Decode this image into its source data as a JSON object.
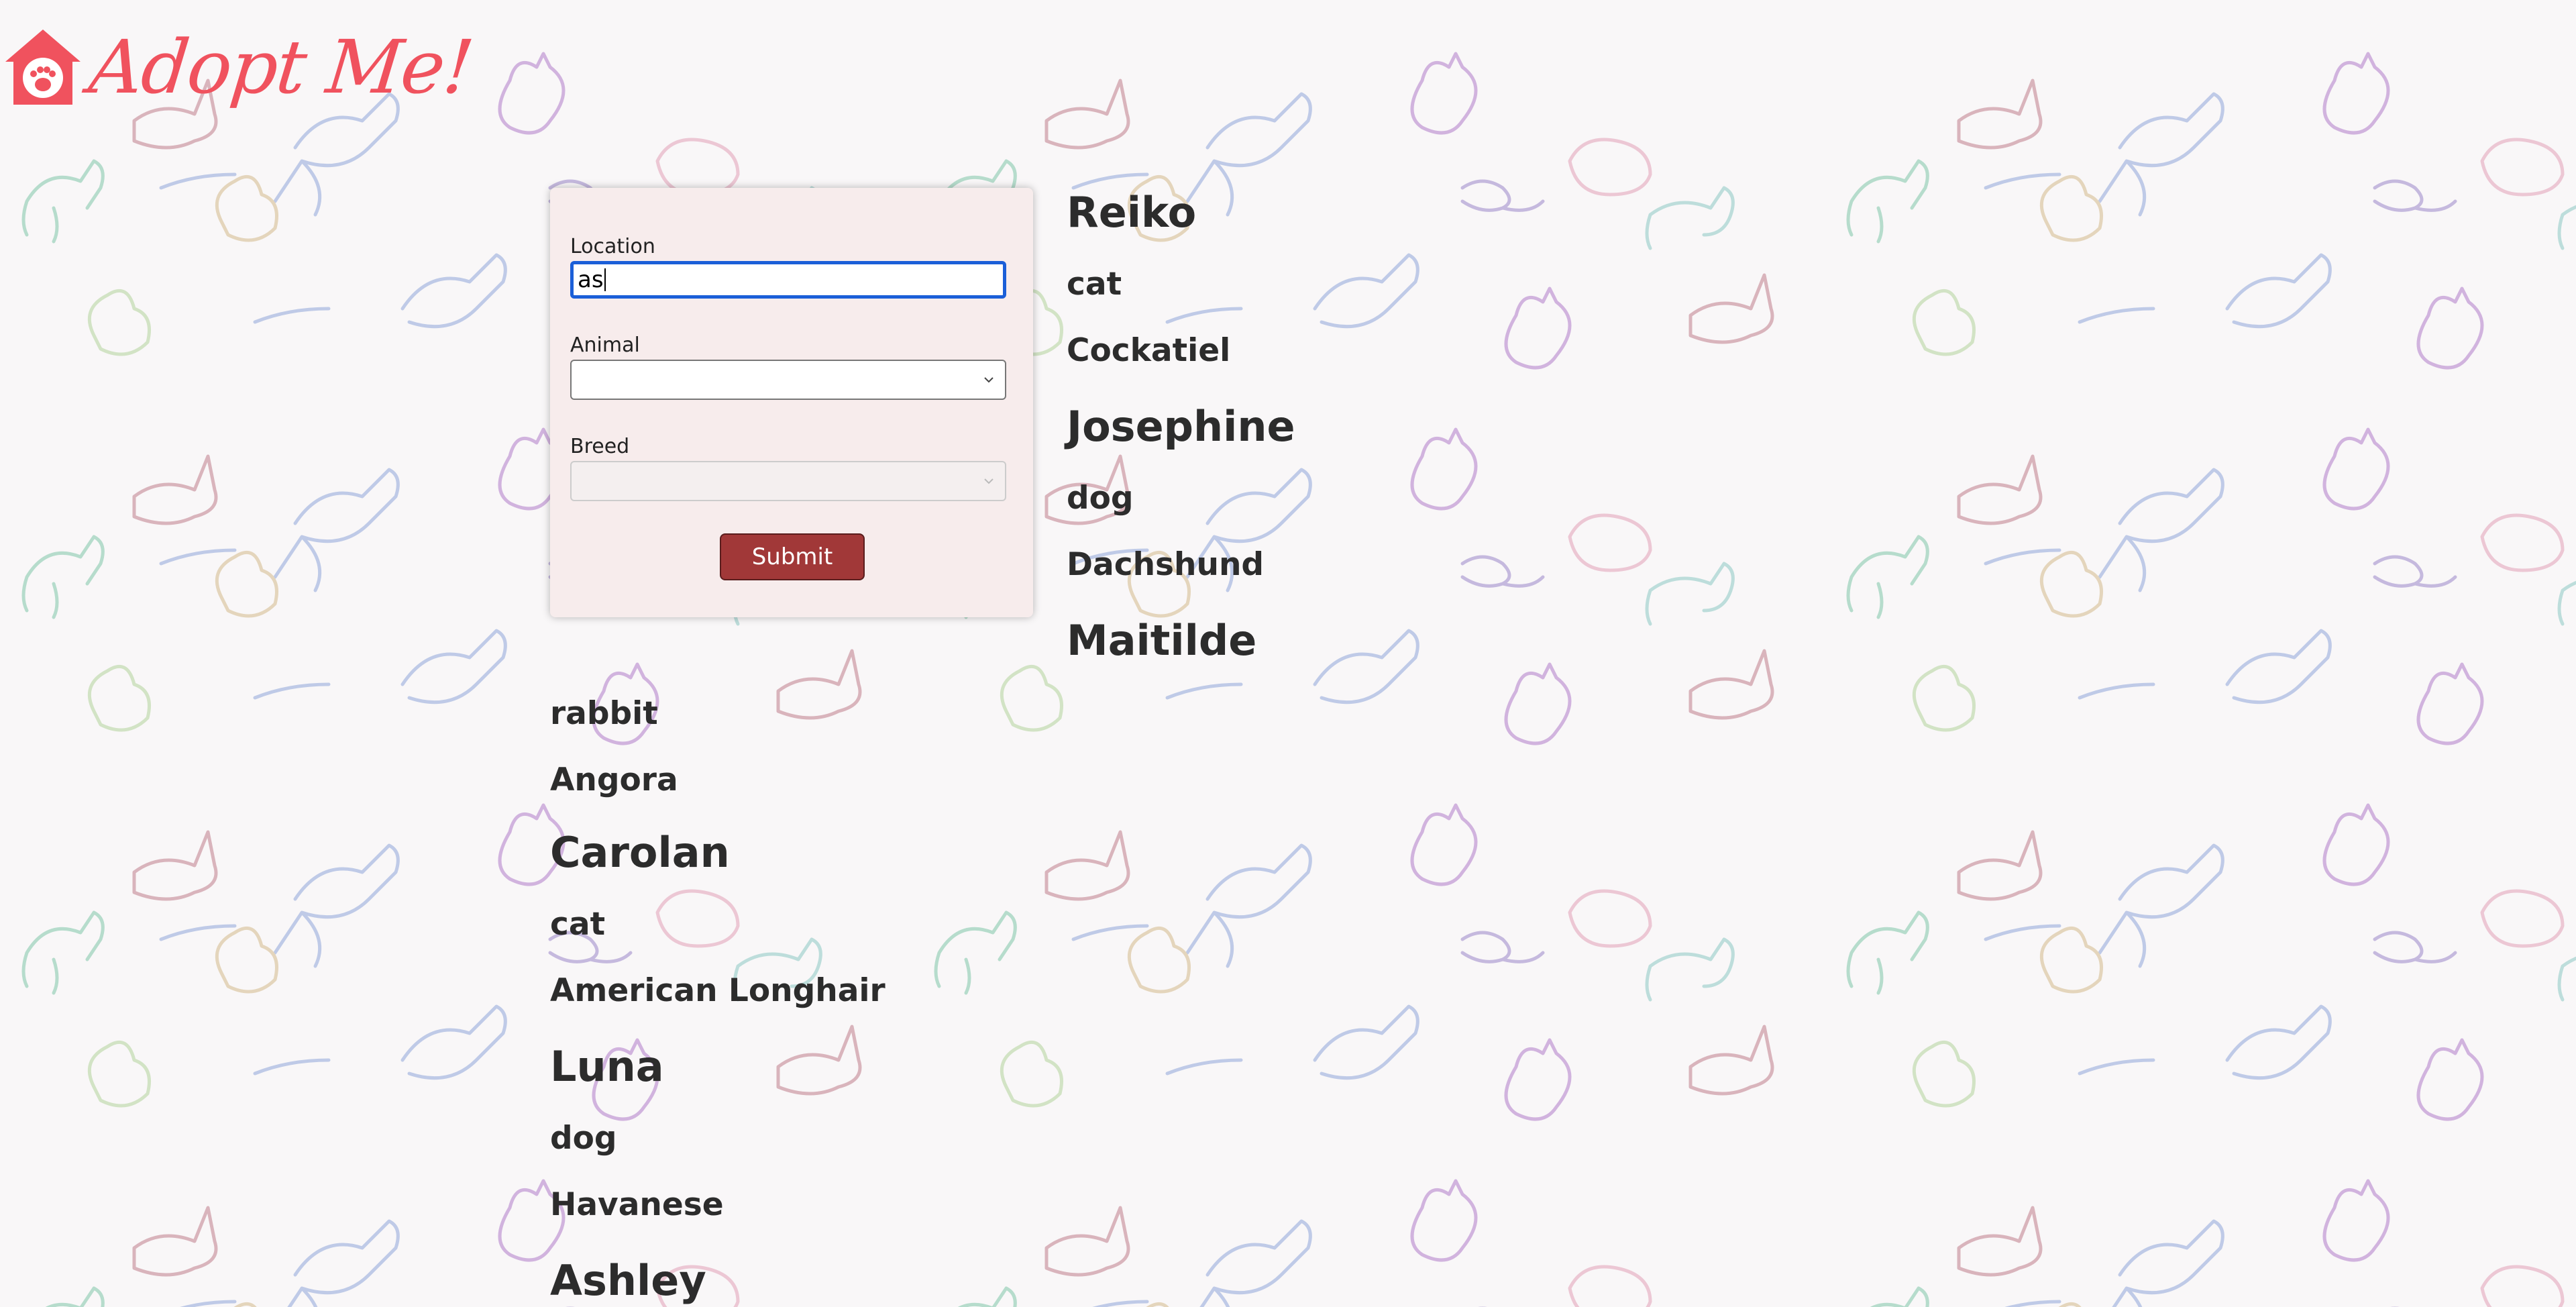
{
  "logo": {
    "text": "Adopt Me!",
    "icon": "house-paw-icon",
    "color": "#f0525e"
  },
  "search": {
    "location_label": "Location",
    "location_value": "as",
    "animal_label": "Animal",
    "animal_value": "",
    "breed_label": "Breed",
    "breed_value": "",
    "breed_disabled": true,
    "submit_label": "Submit",
    "submit_color": "#a13838"
  },
  "pets": [
    {
      "name": "Reiko",
      "animal": "cat",
      "breed": "Cockatiel"
    },
    {
      "name": "Josephine",
      "animal": "dog",
      "breed": "Dachshund"
    },
    {
      "name": "Maitilde",
      "animal": "rabbit",
      "breed": "Angora"
    },
    {
      "name": "Carolan",
      "animal": "cat",
      "breed": "American Longhair"
    },
    {
      "name": "Luna",
      "animal": "dog",
      "breed": "Havanese"
    },
    {
      "name": "Ashley",
      "animal": "",
      "breed": ""
    }
  ]
}
